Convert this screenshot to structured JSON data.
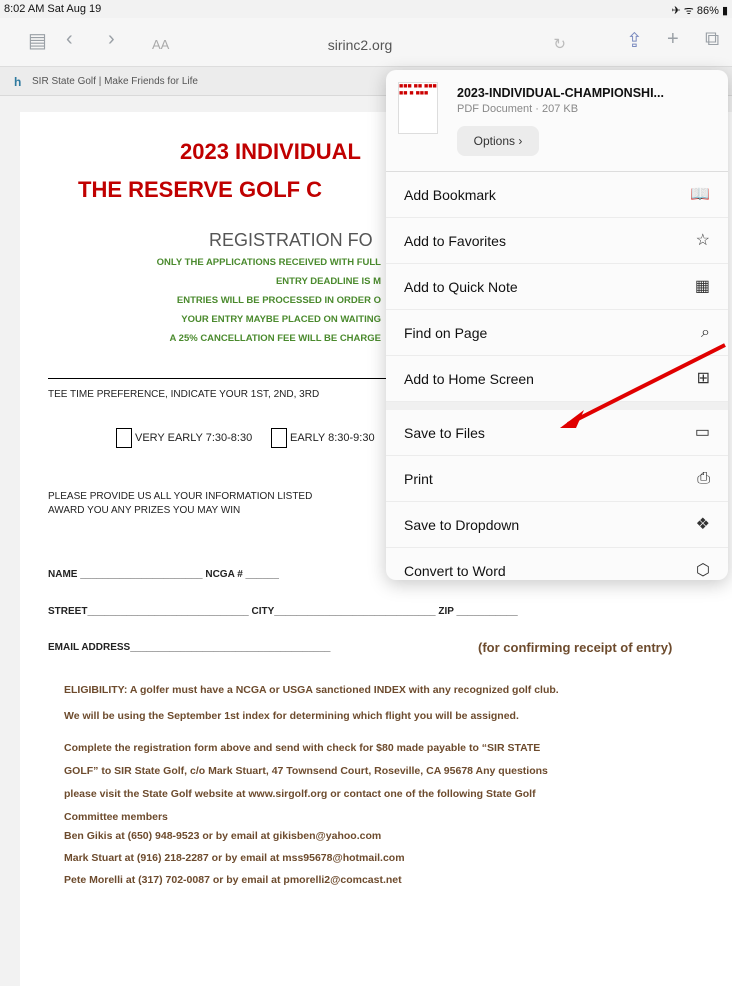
{
  "status": {
    "time": "8:02 AM  Sat Aug 19",
    "right": "✈ ᯤ 86% ▮"
  },
  "browser": {
    "url": "sirinc2.org",
    "aa": "AA",
    "tab": "SIR State Golf | Make Friends for Life"
  },
  "document": {
    "title1": "2023 INDIVIDUAL",
    "title2": "THE RESERVE GOLF C",
    "registration": "REGISTRATION FO",
    "notices": [
      "ONLY THE APPLICATIONS RECEIVED WITH FULL",
      "ENTRY DEADLINE IS M",
      "ENTRIES WILL BE PROCESSED IN ORDER O",
      "YOUR ENTRY MAYBE PLACED ON WAITING",
      "A 25% CANCELLATION FEE WILL BE CHARGE"
    ],
    "tee_pref": "TEE TIME PREFERENCE, INDICATE YOUR 1ST, 2ND, 3RD",
    "very_early": "VERY EARLY 7:30-8:30",
    "early": "EARLY 8:30-9:30",
    "provide": "PLEASE PROVIDE US ALL YOUR INFORMATION LISTED",
    "award": "AWARD YOU ANY PRIZES YOU MAY WIN",
    "name_line": "NAME ______________________ NCGA # ______",
    "street_line": "STREET_____________________________ CITY_____________________________ ZIP ___________",
    "email_line": "EMAIL ADDRESS____________________________________",
    "email_note": "(for confirming receipt of entry)",
    "eligibility1": "ELIGIBILITY:  A golfer must have a NCGA or USGA sanctioned INDEX with any recognized golf club.",
    "eligibility2": "We will be using the  September  1st index for determining which flight you will be assigned.",
    "complete": [
      "Complete the registration form above and send with check for $80 made payable to “SIR STATE",
      "GOLF” to SIR State Golf, c/o Mark Stuart, 47 Townsend Court, Roseville, CA 95678  Any questions",
      "please visit the State Golf website at www.sirgolf.org or contact one of the following State Golf",
      "Committee members"
    ],
    "contacts": [
      "Ben Gikis at (650) 948-9523 or by email at gikisben@yahoo.com",
      "Mark Stuart at (916) 218-2287 or by email at mss95678@hotmail.com",
      "Pete Morelli at (317) 702-0087 or by email at pmorelli2@comcast.net"
    ]
  },
  "share": {
    "file_name": "2023-INDIVIDUAL-CHAMPIONSHI...",
    "file_meta": "PDF Document · 207 KB",
    "options": "Options ›",
    "items": [
      "Add Bookmark",
      "Add to Favorites",
      "Add to Quick Note",
      "Find on Page",
      "Add to Home Screen",
      "Save to Files",
      "Print",
      "Save to Dropdown",
      "Convert to Word"
    ],
    "icons": [
      "book-icon",
      "star-icon",
      "note-icon",
      "find-icon",
      "add-home-icon",
      "folder-icon",
      "print-icon",
      "dropbox-icon",
      "word-icon"
    ]
  },
  "colors": {
    "title_red": "#c00000",
    "notice_green": "#4a8a2d",
    "arrow_red": "#e00000"
  }
}
